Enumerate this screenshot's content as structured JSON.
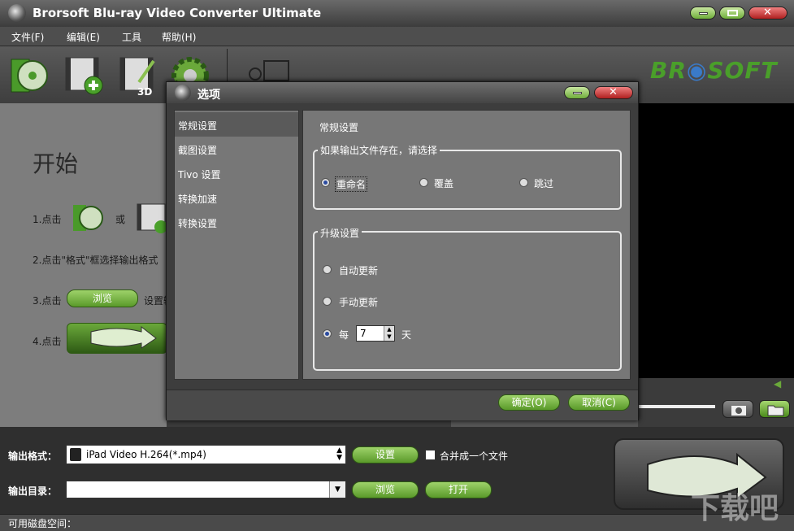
{
  "app": {
    "title": "Brorsoft Blu-ray Video Converter Ultimate",
    "brand": "BR O SOFT"
  },
  "menu": [
    "文件(F)",
    "编辑(E)",
    "工具",
    "帮助(H)"
  ],
  "left": {
    "start": "开始",
    "step1": "1.点击",
    "step1_or": "或",
    "step2": "2.点击\"格式\"框选择输出格式",
    "step3": "3.点击",
    "step3_btn": "浏览",
    "step3_tail": "设置输",
    "step4": "4.点击"
  },
  "dialog": {
    "title": "选项",
    "nav": [
      "常规设置",
      "截图设置",
      "Tivo 设置",
      "转换加速",
      "转换设置"
    ],
    "section_title": "常规设置",
    "exists_legend": "如果输出文件存在，请选择",
    "exists_options": [
      "重命名",
      "覆盖",
      "跳过"
    ],
    "update_legend": "升级设置",
    "update_auto": "自动更新",
    "update_manual": "手动更新",
    "update_every": "每",
    "update_days_value": "7",
    "update_days_unit": "天",
    "ok": "确定(O)",
    "cancel": "取消(C)"
  },
  "bottom": {
    "format_label": "输出格式：",
    "format_value": "iPad Video H.264(*.mp4)",
    "settings_btn": "设置",
    "merge_label": "合并成一个文件",
    "dir_label": "输出目录：",
    "dir_value": "",
    "browse_btn": "浏览",
    "open_btn": "打开",
    "disk_label": "可用磁盘空间："
  },
  "watermark": "下载吧"
}
